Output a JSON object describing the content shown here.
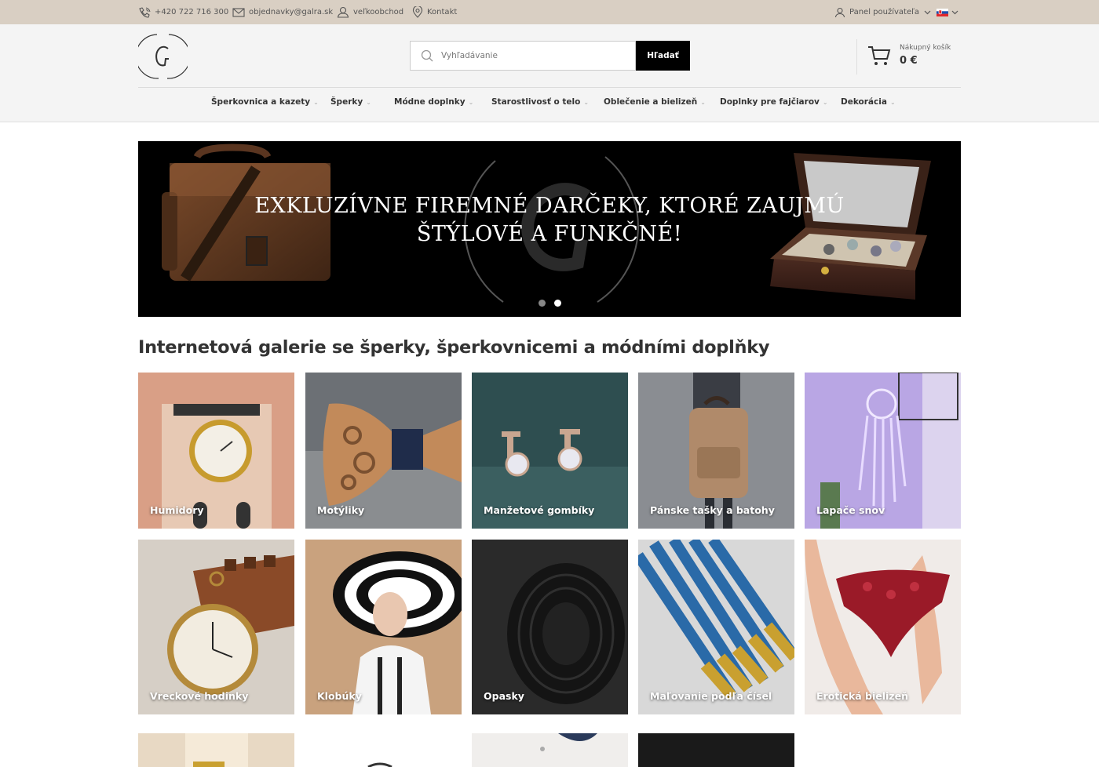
{
  "topbar": {
    "phone": "+420 722 716 300",
    "email": "objednavky@galra.sk",
    "wholesale": "veľkoobchod",
    "contact": "Kontakt",
    "user_panel": "Panel používateľa"
  },
  "search": {
    "placeholder": "Vyhľadávanie",
    "button": "Hľadať"
  },
  "cart": {
    "label": "Nákupný košík",
    "total": "0 €"
  },
  "nav": {
    "items": [
      {
        "label": "Šperkovnica a kazety"
      },
      {
        "label": "Šperky"
      },
      {
        "label": "Módne doplnky"
      },
      {
        "label": "Starostlivosť o telo"
      },
      {
        "label": "Oblečenie a bielizeň"
      },
      {
        "label": "Doplnky pre fajčiarov"
      },
      {
        "label": "Dekorácia"
      }
    ]
  },
  "banner": {
    "line1": "EXKLUZÍVNE FIREMNÉ DARČEKY, KTORÉ ZAUJMÚ",
    "line2": "ŠTÝLOVÉ A FUNKČNÉ!",
    "slides": 2,
    "active_slide": 2
  },
  "main": {
    "heading": "Internetová galerie se šperky, šperkovnicemi a módními doplňky",
    "categories": [
      {
        "label": "Humidory",
        "icon": "humidor-image"
      },
      {
        "label": "Motýliky",
        "icon": "bow-tie-image"
      },
      {
        "label": "Manžetové gombíky",
        "icon": "cufflinks-image"
      },
      {
        "label": "Pánske tašky a batohy",
        "icon": "backpack-image"
      },
      {
        "label": "Lapače snov",
        "icon": "dreamcatcher-image"
      },
      {
        "label": "Vreckové hodinky",
        "icon": "pocket-watch-image"
      },
      {
        "label": "Klobúky",
        "icon": "hat-image"
      },
      {
        "label": "Opasky",
        "icon": "belt-image"
      },
      {
        "label": "Maľovanie podľa čísel",
        "icon": "paintbrushes-image"
      },
      {
        "label": "Erotická bielizeň",
        "icon": "lingerie-image"
      }
    ]
  },
  "colors": {
    "topbar_bg": "#d9cfc3",
    "header_bg": "#f4f4f4",
    "accent": "#000000"
  }
}
